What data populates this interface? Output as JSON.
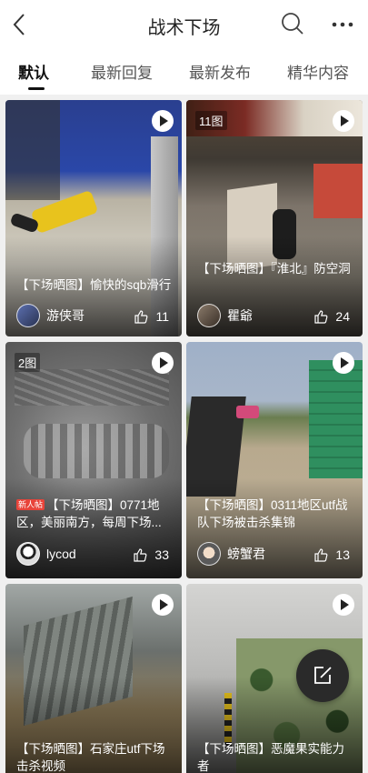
{
  "header": {
    "title": "战术下场",
    "back_icon": "chevron-left-icon",
    "search_icon": "search-icon",
    "more_icon": "more-dots-icon"
  },
  "tabs": [
    {
      "label": "默认",
      "active": true
    },
    {
      "label": "最新回复",
      "active": false
    },
    {
      "label": "最新发布",
      "active": false
    },
    {
      "label": "精华内容",
      "active": false
    }
  ],
  "posts": [
    {
      "caption": "【下场晒图】愉快的sqb滑行",
      "author": "游侠哥",
      "likes": "11",
      "type": "video"
    },
    {
      "image_count": "11图",
      "caption": "【下场晒图】『淮北』防空洞",
      "author": "瞿爺",
      "likes": "24",
      "type": "video"
    },
    {
      "image_count": "2图",
      "badge": "新人帖",
      "caption": "【下场晒图】0771地区，美丽南方，每周下场...",
      "author": "lycod",
      "likes": "33",
      "type": "video"
    },
    {
      "caption": "【下场晒图】0311地区utf战队下场被击杀集锦",
      "author": "螃蟹君",
      "likes": "13",
      "type": "video"
    },
    {
      "caption": "【下场晒图】石家庄utf下场击杀视频",
      "type": "video"
    },
    {
      "caption": "【下场晒图】恶魔果实能力者",
      "type": "video"
    }
  ],
  "fab": {
    "icon": "compose-edit-icon"
  }
}
